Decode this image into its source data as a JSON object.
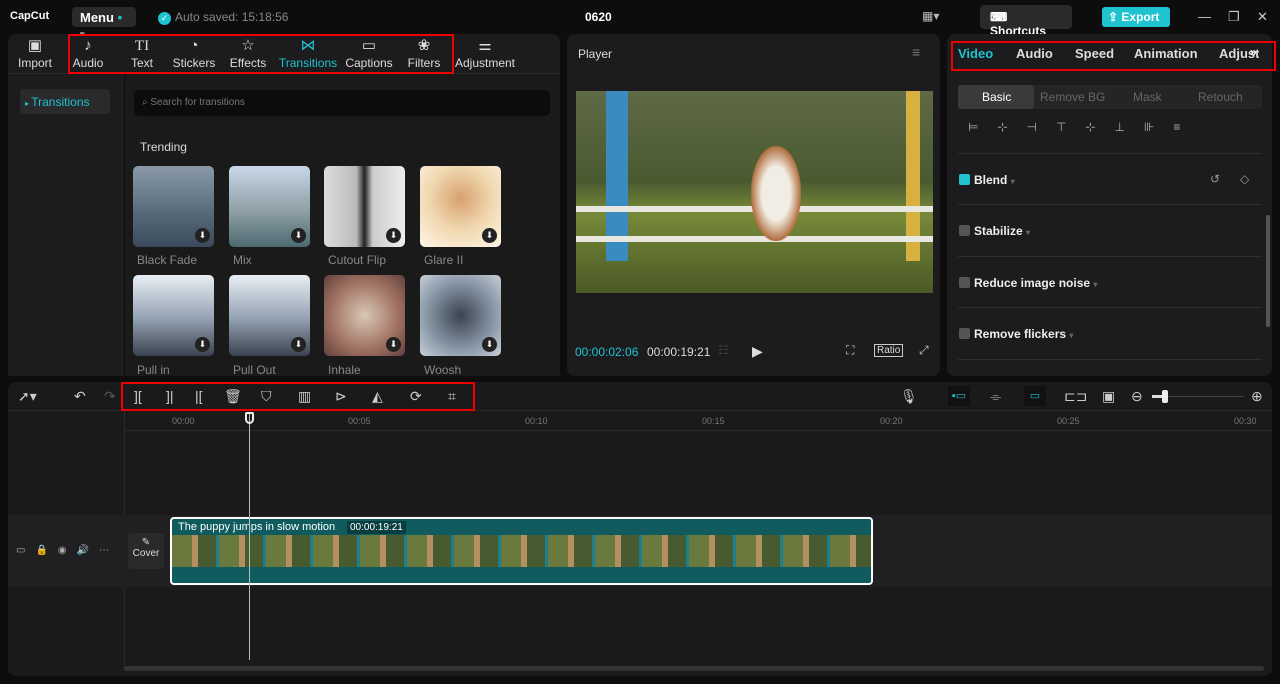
{
  "topbar": {
    "logo": "CapCut",
    "menu": "Menu",
    "autosaved": "Auto saved: 15:18:56",
    "project_title": "0620",
    "shortcuts": "Shortcuts",
    "export": "Export"
  },
  "toolbar_tabs": [
    {
      "label": "Import",
      "icon": "import-icon"
    },
    {
      "label": "Audio",
      "icon": "audio-icon"
    },
    {
      "label": "Text",
      "icon": "text-icon"
    },
    {
      "label": "Stickers",
      "icon": "stickers-icon"
    },
    {
      "label": "Effects",
      "icon": "effects-icon"
    },
    {
      "label": "Transitions",
      "icon": "transitions-icon"
    },
    {
      "label": "Captions",
      "icon": "captions-icon"
    },
    {
      "label": "Filters",
      "icon": "filters-icon"
    },
    {
      "label": "Adjustment",
      "icon": "adjustment-icon"
    }
  ],
  "left_nav": {
    "active": "Transitions"
  },
  "search": {
    "placeholder": "Search for transitions"
  },
  "section": "Trending",
  "transitions": [
    "Black Fade",
    "Mix",
    "Cutout Flip",
    "Glare II",
    "Pull in",
    "Pull Out",
    "Inhale",
    "Woosh"
  ],
  "player": {
    "title": "Player",
    "current_time": "00:00:02:06",
    "total_time": "00:00:19:21",
    "ratio": "Ratio"
  },
  "right_tabs": [
    "Video",
    "Audio",
    "Speed",
    "Animation",
    "Adjustme"
  ],
  "sub_tabs": [
    "Basic",
    "Remove BG",
    "Mask",
    "Retouch"
  ],
  "options": [
    {
      "label": "Blend",
      "checked": true
    },
    {
      "label": "Stabilize",
      "checked": false
    },
    {
      "label": "Reduce image noise",
      "checked": false
    },
    {
      "label": "Remove flickers",
      "checked": false
    }
  ],
  "timeline": {
    "ticks": [
      "00:00",
      "00:05",
      "00:10",
      "00:15",
      "00:20",
      "00:25",
      "00:30"
    ],
    "clip_title": "The puppy jumps in slow motion",
    "clip_duration": "00:00:19:21",
    "cover": "Cover"
  },
  "colors": {
    "accent": "#1fc3d0",
    "highlight": "#e00000"
  }
}
